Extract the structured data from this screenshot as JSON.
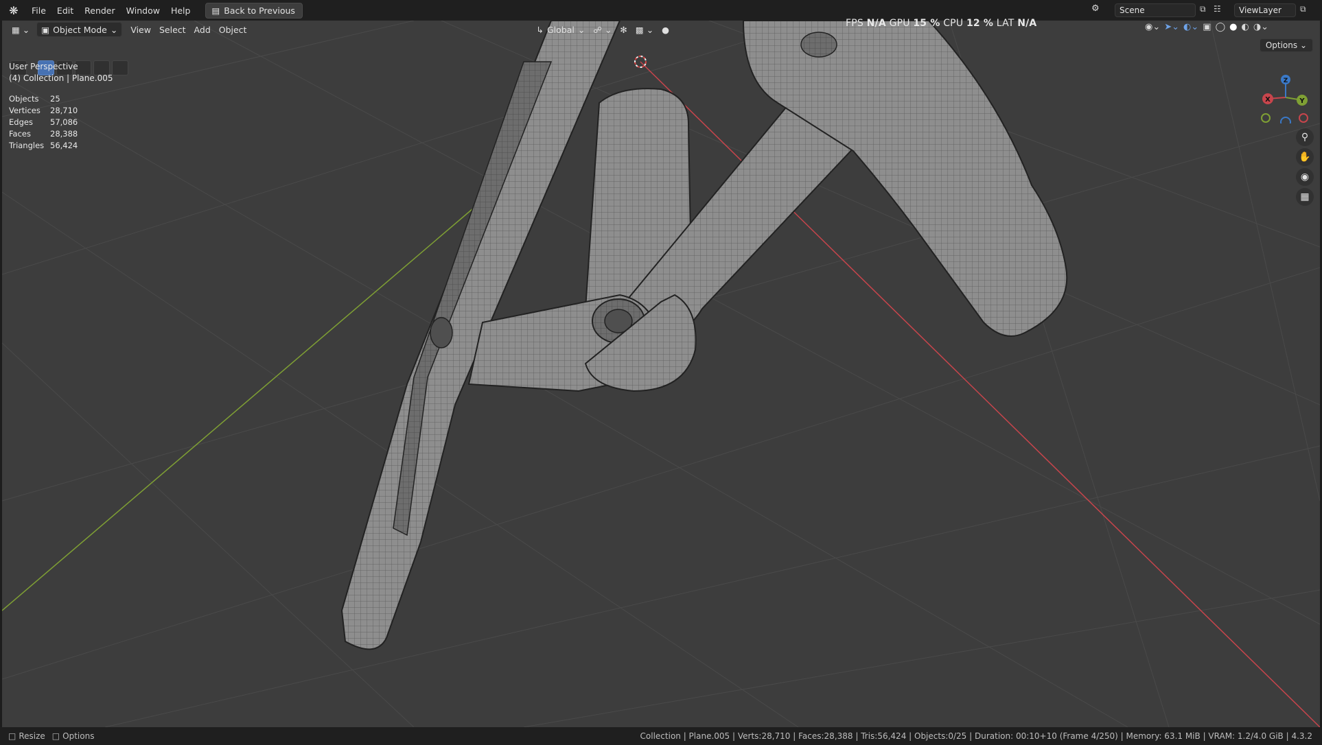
{
  "menubar": {
    "items": [
      "File",
      "Edit",
      "Render",
      "Window",
      "Help"
    ],
    "back_button": "Back to Previous",
    "scene": "Scene",
    "view_layer": "ViewLayer"
  },
  "viewport_header": {
    "mode": "Object Mode",
    "menus": [
      "View",
      "Select",
      "Add",
      "Object"
    ],
    "transform_orientation": "Global",
    "options_label": "Options"
  },
  "perf": {
    "fps_label": "FPS",
    "fps_value": "N/A",
    "gpu_label": "GPU",
    "gpu_value": "15 %",
    "cpu_label": "CPU",
    "cpu_value": "12 %",
    "lat_label": "LAT",
    "lat_value": "N/A"
  },
  "overlay": {
    "view_name": "User Perspective",
    "collection_path": "(4) Collection | Plane.005",
    "stats": [
      {
        "label": "Objects",
        "value": "25"
      },
      {
        "label": "Vertices",
        "value": "28,710"
      },
      {
        "label": "Edges",
        "value": "57,086"
      },
      {
        "label": "Faces",
        "value": "28,388"
      },
      {
        "label": "Triangles",
        "value": "56,424"
      }
    ]
  },
  "gizmo": {
    "x": "X",
    "y": "Y",
    "z": "Z"
  },
  "statusbar": {
    "left_1": "Resize",
    "left_2": "Options",
    "right": "Collection | Plane.005 | Verts:28,710 | Faces:28,388 | Tris:56,424 | Objects:0/25 | Duration: 00:10+10 (Frame 4/250) | Memory: 63.1 MiB | VRAM: 1.2/4.0 GiB | 4.3.2"
  },
  "colors": {
    "x_axis": "#c8454c",
    "y_axis": "#7fa034",
    "z_axis": "#3a79c8",
    "accent": "#4772b3"
  }
}
